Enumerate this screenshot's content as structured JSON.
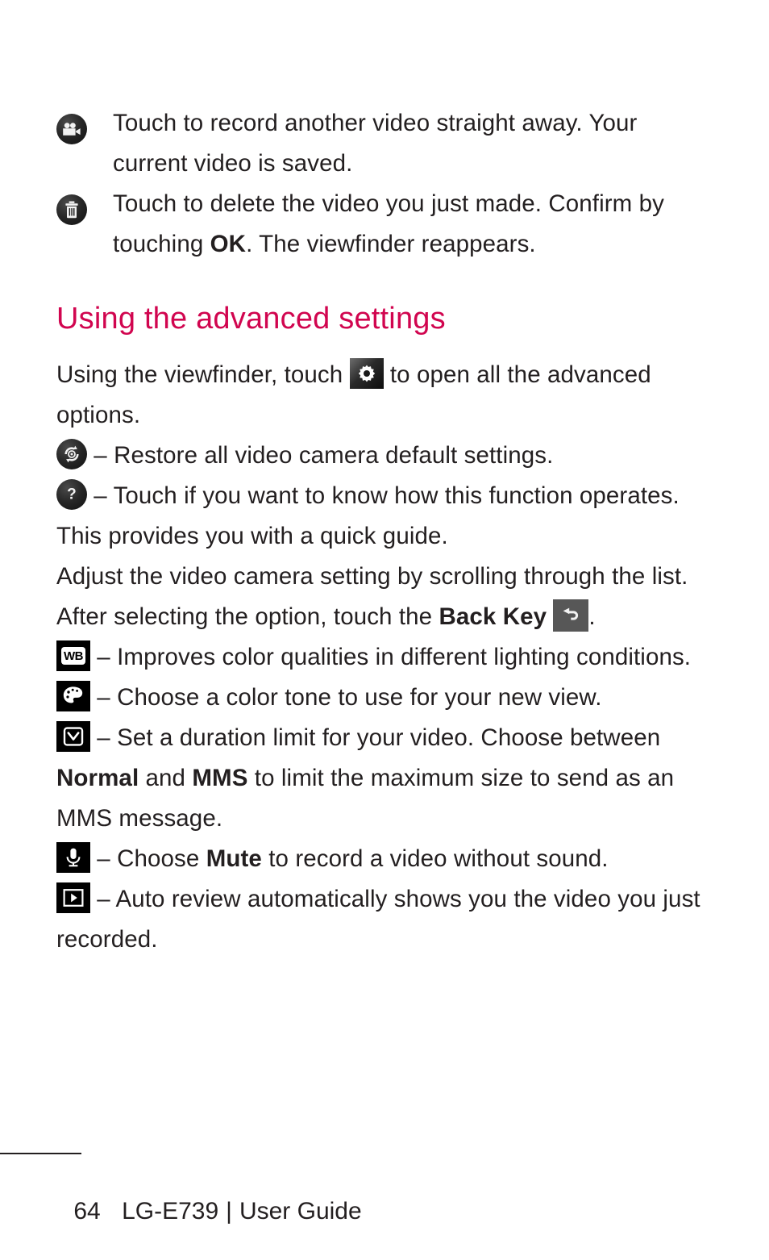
{
  "page": {
    "product": "LG-E739",
    "doc_type": "User Guide",
    "page_number": "64",
    "footer_separator": "|",
    "accent_color": "#d1054f",
    "text_color": "#231f20",
    "background_color": "#ffffff"
  },
  "top_items": [
    {
      "icon": "video-camera-icon",
      "icon_style": "dark-circle",
      "text": "Touch to record another video straight away. Your current video is saved."
    },
    {
      "icon": "trash-delete-icon",
      "icon_style": "dark-circle",
      "text_part_1": "Touch to delete the video you just made. Confirm by touching ",
      "bold_1": "OK",
      "text_part_2": ". The viewfinder reappears."
    }
  ],
  "section": {
    "heading": "Using the advanced settings",
    "intro_part_1": "Using the viewfinder, touch ",
    "intro_icon": "gear-settings-icon",
    "intro_part_2": " to open all the advanced options."
  },
  "settings_items": [
    {
      "icon": "restore-defaults-icon",
      "icon_style": "dark-circle",
      "text": "– Restore all video camera default settings."
    },
    {
      "icon": "help-question-icon",
      "icon_style": "dark-circle",
      "text": "– Touch if you want to know how this function operates. This provides you with a quick guide."
    }
  ],
  "back_key_paragraph": {
    "text_part_1": "Adjust the video camera setting by scrolling through the list. After selecting the option, touch the ",
    "bold_1": "Back Key",
    "icon": "back-arrow-icon",
    "text_part_2": "."
  },
  "icon_list": [
    {
      "icon": "white-balance-wb-icon",
      "label": "WB",
      "text": "– Improves color qualities in different lighting conditions."
    },
    {
      "icon": "color-palette-icon",
      "text": "– Choose a color tone to use for your new view."
    },
    {
      "icon": "duration-limit-clock-icon",
      "text_part_1": "– Set a duration limit for your video. Choose between ",
      "bold_1": "Normal",
      "text_mid": " and ",
      "bold_2": "MMS",
      "text_part_2": " to limit the maximum size to send as an MMS message."
    },
    {
      "icon": "microphone-icon",
      "text_part_1": "– Choose ",
      "bold_1": "Mute",
      "text_part_2": " to record a video without sound."
    },
    {
      "icon": "auto-review-play-icon",
      "text": "– Auto review automatically shows you the video you just recorded."
    }
  ]
}
